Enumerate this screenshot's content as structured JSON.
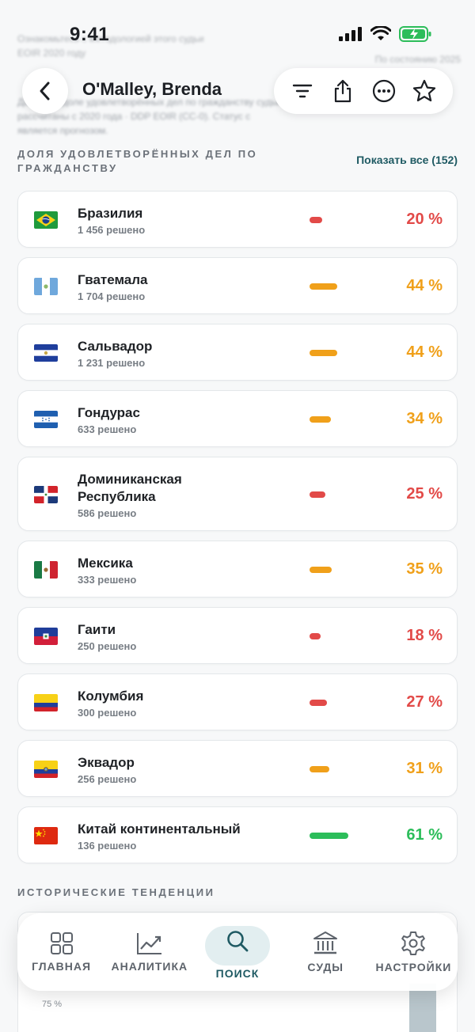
{
  "status": {
    "time": "9:41"
  },
  "background": {
    "line1": "Ознакомьтесь с методологией этого судьи",
    "line2": "EOIR 2020 году",
    "right": "По состоянию 2025",
    "desc1": "Данные о доле удовлетворённых дел по гражданству судьи. Показатели",
    "desc2": "рассчитаны с 2020 года · DDP EOIR (CC-0). Статус с",
    "desc3": "является прогнозом."
  },
  "header": {
    "title": "O'Malley, Brenda"
  },
  "section": {
    "title": "ДОЛЯ УДОВЛЕТВОРЁННЫХ ДЕЛ ПО ГРАЖДАНСТВУ",
    "show_all": "Показать все (152)"
  },
  "countries": [
    {
      "name": "Бразилия",
      "decided": "1 456 решено",
      "rate": "20 %",
      "rate_value": 20,
      "level": "red",
      "flag": "brazil"
    },
    {
      "name": "Гватемала",
      "decided": "1 704 решено",
      "rate": "44 %",
      "rate_value": 44,
      "level": "orange",
      "flag": "guatemala"
    },
    {
      "name": "Сальвадор",
      "decided": "1 231 решено",
      "rate": "44 %",
      "rate_value": 44,
      "level": "orange",
      "flag": "salvador"
    },
    {
      "name": "Гондурас",
      "decided": "633 решено",
      "rate": "34 %",
      "rate_value": 34,
      "level": "orange",
      "flag": "honduras"
    },
    {
      "name": "Доминиканская Республика",
      "decided": "586 решено",
      "rate": "25 %",
      "rate_value": 25,
      "level": "red",
      "flag": "dominican"
    },
    {
      "name": "Мексика",
      "decided": "333 решено",
      "rate": "35 %",
      "rate_value": 35,
      "level": "orange",
      "flag": "mexico"
    },
    {
      "name": "Гаити",
      "decided": "250 решено",
      "rate": "18 %",
      "rate_value": 18,
      "level": "red",
      "flag": "haiti"
    },
    {
      "name": "Колумбия",
      "decided": "300 решено",
      "rate": "27 %",
      "rate_value": 27,
      "level": "red",
      "flag": "colombia"
    },
    {
      "name": "Эквадор",
      "decided": "256 решено",
      "rate": "31 %",
      "rate_value": 31,
      "level": "orange",
      "flag": "ecuador"
    },
    {
      "name": "Китай континентальный",
      "decided": "136 решено",
      "rate": "61 %",
      "rate_value": 61,
      "level": "green",
      "flag": "china"
    }
  ],
  "trends": {
    "title": "ИСТОРИЧЕСКИЕ ТЕНДЕНЦИИ",
    "y_label": "75 %"
  },
  "tabs": [
    {
      "label": "ГЛАВНАЯ",
      "icon": "grid-icon"
    },
    {
      "label": "АНАЛИТИКА",
      "icon": "chart-icon"
    },
    {
      "label": "ПОИСК",
      "icon": "search-icon",
      "active": true
    },
    {
      "label": "СУДЫ",
      "icon": "court-icon"
    },
    {
      "label": "НАСТРОЙКИ",
      "icon": "gear-icon"
    }
  ],
  "colors": {
    "red": "#e24a48",
    "orange": "#f0a01a",
    "green": "#2cbd5a",
    "accent": "#1f5a63"
  }
}
